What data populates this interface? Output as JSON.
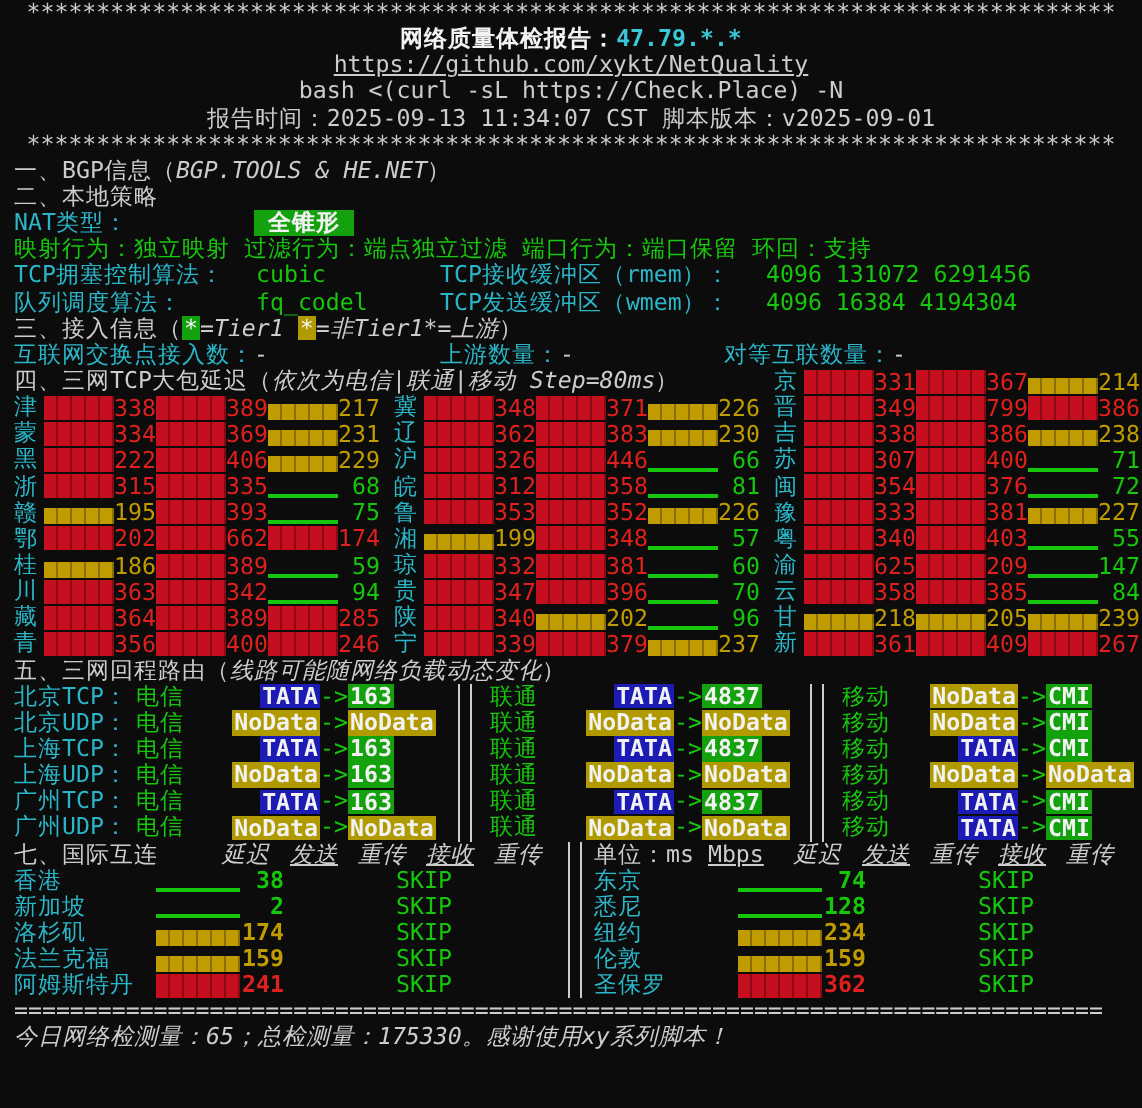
{
  "header_rules": [
    "******************************************************************************",
    "******************************************************************************"
  ],
  "title": {
    "label": "网络质量体检报告：",
    "ip": "47.79.*.*"
  },
  "repo_url": "https://github.com/xykt/NetQuality",
  "command": "bash <(curl -sL https://Check.Place) -N",
  "report_info": "报告时间：2025-09-13 11:34:07 CST  脚本版本：v2025-09-01",
  "bgp": {
    "heading": "一、BGP信息（*BGP.TOOLS & HE.NET*）"
  },
  "local_policy": {
    "heading": "二、本地策略",
    "nat_label": "NAT类型：",
    "nat_type": "全锥形",
    "behaviors": [
      {
        "label": "映射行为：",
        "value": "独立映射"
      },
      {
        "label": "过滤行为：",
        "value": "端点独立过滤"
      },
      {
        "label": "端口行为：",
        "value": "端口保留"
      },
      {
        "label": "环回：",
        "value": "支持"
      }
    ],
    "settings": [
      {
        "label": "TCP拥塞控制算法：",
        "value": "cubic",
        "buffer_label": "TCP接收缓冲区（rmem）：",
        "buffer_value": "4096 131072 6291456"
      },
      {
        "label": "队列调度算法：",
        "value": "fq_codel",
        "buffer_label": "TCP发送缓冲区（wmem）：",
        "buffer_value": "4096 16384 4194304"
      }
    ]
  },
  "access": {
    "heading": "三、接入信息（",
    "legend": [
      {
        "kind": "tier1",
        "mark": "*",
        "text": "=Tier1"
      },
      {
        "kind": "non_tier1",
        "mark": "*",
        "text": "=非Tier1"
      },
      {
        "kind": "upstream",
        "text": "*=上游"
      }
    ],
    "heading_end": "）",
    "counts": [
      {
        "label": "互联网交换点接入数：",
        "value": "-"
      },
      {
        "label": "上游数量：",
        "value": "-"
      },
      {
        "label": "对等互联数量：",
        "value": "-"
      }
    ]
  },
  "tcp_latency": {
    "heading": "四、三网TCP大包延迟（*依次为电信|联通|移动 Step=80ms*）",
    "regions": [
      {
        "name": "京",
        "latencies": [
          {
            "value": "331",
            "kind": "high"
          },
          {
            "value": "367",
            "kind": "high"
          },
          {
            "value": "214",
            "kind": "mid"
          }
        ]
      },
      {
        "name": "津",
        "latencies": [
          {
            "value": "338",
            "kind": "high"
          },
          {
            "value": "389",
            "kind": "high"
          },
          {
            "value": "217",
            "kind": "mid"
          }
        ]
      },
      {
        "name": "冀",
        "latencies": [
          {
            "value": "348",
            "kind": "high"
          },
          {
            "value": "371",
            "kind": "high"
          },
          {
            "value": "226",
            "kind": "mid"
          }
        ]
      },
      {
        "name": "晋",
        "latencies": [
          {
            "value": "349",
            "kind": "high"
          },
          {
            "value": "799",
            "kind": "high"
          },
          {
            "value": "386",
            "kind": "high"
          }
        ]
      },
      {
        "name": "蒙",
        "latencies": [
          {
            "value": "334",
            "kind": "high"
          },
          {
            "value": "369",
            "kind": "high"
          },
          {
            "value": "231",
            "kind": "mid"
          }
        ]
      },
      {
        "name": "辽",
        "latencies": [
          {
            "value": "362",
            "kind": "high"
          },
          {
            "value": "383",
            "kind": "high"
          },
          {
            "value": "230",
            "kind": "mid"
          }
        ]
      },
      {
        "name": "吉",
        "latencies": [
          {
            "value": "338",
            "kind": "high"
          },
          {
            "value": "386",
            "kind": "high"
          },
          {
            "value": "238",
            "kind": "mid"
          }
        ]
      },
      {
        "name": "黑",
        "latencies": [
          {
            "value": "222",
            "kind": "high"
          },
          {
            "value": "406",
            "kind": "high"
          },
          {
            "value": "229",
            "kind": "mid"
          }
        ]
      },
      {
        "name": "沪",
        "latencies": [
          {
            "value": "326",
            "kind": "high"
          },
          {
            "value": "446",
            "kind": "high"
          },
          {
            "value": "66",
            "kind": "low"
          }
        ]
      },
      {
        "name": "苏",
        "latencies": [
          {
            "value": "307",
            "kind": "high"
          },
          {
            "value": "400",
            "kind": "high"
          },
          {
            "value": "71",
            "kind": "low"
          }
        ]
      },
      {
        "name": "浙",
        "latencies": [
          {
            "value": "315",
            "kind": "high"
          },
          {
            "value": "335",
            "kind": "high"
          },
          {
            "value": "68",
            "kind": "low"
          }
        ]
      },
      {
        "name": "皖",
        "latencies": [
          {
            "value": "312",
            "kind": "high"
          },
          {
            "value": "358",
            "kind": "high"
          },
          {
            "value": "81",
            "kind": "low"
          }
        ]
      },
      {
        "name": "闽",
        "latencies": [
          {
            "value": "354",
            "kind": "high"
          },
          {
            "value": "376",
            "kind": "high"
          },
          {
            "value": "72",
            "kind": "low"
          }
        ]
      },
      {
        "name": "赣",
        "latencies": [
          {
            "value": "195",
            "kind": "mid"
          },
          {
            "value": "393",
            "kind": "high"
          },
          {
            "value": "75",
            "kind": "low"
          }
        ]
      },
      {
        "name": "鲁",
        "latencies": [
          {
            "value": "353",
            "kind": "high"
          },
          {
            "value": "352",
            "kind": "high"
          },
          {
            "value": "226",
            "kind": "mid"
          }
        ]
      },
      {
        "name": "豫",
        "latencies": [
          {
            "value": "333",
            "kind": "high"
          },
          {
            "value": "381",
            "kind": "high"
          },
          {
            "value": "227",
            "kind": "mid"
          }
        ]
      },
      {
        "name": "鄂",
        "latencies": [
          {
            "value": "202",
            "kind": "high"
          },
          {
            "value": "662",
            "kind": "high"
          },
          {
            "value": "174",
            "kind": "high"
          }
        ]
      },
      {
        "name": "湘",
        "latencies": [
          {
            "value": "199",
            "kind": "mid"
          },
          {
            "value": "348",
            "kind": "high"
          },
          {
            "value": "57",
            "kind": "low"
          }
        ]
      },
      {
        "name": "粤",
        "latencies": [
          {
            "value": "340",
            "kind": "high"
          },
          {
            "value": "403",
            "kind": "high"
          },
          {
            "value": "55",
            "kind": "low"
          }
        ]
      },
      {
        "name": "桂",
        "latencies": [
          {
            "value": "186",
            "kind": "mid"
          },
          {
            "value": "389",
            "kind": "high"
          },
          {
            "value": "59",
            "kind": "low"
          }
        ]
      },
      {
        "name": "琼",
        "latencies": [
          {
            "value": "332",
            "kind": "high"
          },
          {
            "value": "381",
            "kind": "high"
          },
          {
            "value": "60",
            "kind": "low"
          }
        ]
      },
      {
        "name": "渝",
        "latencies": [
          {
            "value": "625",
            "kind": "high"
          },
          {
            "value": "209",
            "kind": "high"
          },
          {
            "value": "147",
            "kind": "low"
          }
        ]
      },
      {
        "name": "川",
        "latencies": [
          {
            "value": "363",
            "kind": "high"
          },
          {
            "value": "342",
            "kind": "high"
          },
          {
            "value": "94",
            "kind": "low"
          }
        ]
      },
      {
        "name": "贵",
        "latencies": [
          {
            "value": "347",
            "kind": "high"
          },
          {
            "value": "396",
            "kind": "high"
          },
          {
            "value": "70",
            "kind": "low"
          }
        ]
      },
      {
        "name": "云",
        "latencies": [
          {
            "value": "358",
            "kind": "high"
          },
          {
            "value": "385",
            "kind": "high"
          },
          {
            "value": "84",
            "kind": "low"
          }
        ]
      },
      {
        "name": "藏",
        "latencies": [
          {
            "value": "364",
            "kind": "high"
          },
          {
            "value": "389",
            "kind": "high"
          },
          {
            "value": "285",
            "kind": "high"
          }
        ]
      },
      {
        "name": "陕",
        "latencies": [
          {
            "value": "340",
            "kind": "high"
          },
          {
            "value": "202",
            "kind": "mid"
          },
          {
            "value": "96",
            "kind": "low"
          }
        ]
      },
      {
        "name": "甘",
        "latencies": [
          {
            "value": "218",
            "kind": "mid"
          },
          {
            "value": "205",
            "kind": "mid"
          },
          {
            "value": "239",
            "kind": "mid"
          }
        ]
      },
      {
        "name": "青",
        "latencies": [
          {
            "value": "356",
            "kind": "high"
          },
          {
            "value": "400",
            "kind": "high"
          },
          {
            "value": "246",
            "kind": "high"
          }
        ]
      },
      {
        "name": "宁",
        "latencies": [
          {
            "value": "339",
            "kind": "high"
          },
          {
            "value": "379",
            "kind": "high"
          },
          {
            "value": "237",
            "kind": "mid"
          }
        ]
      },
      {
        "name": "新",
        "latencies": [
          {
            "value": "361",
            "kind": "high"
          },
          {
            "value": "409",
            "kind": "high"
          },
          {
            "value": "267",
            "kind": "high"
          }
        ]
      }
    ]
  },
  "return_routes": {
    "heading": "五、三网回程路由（*线路可能随网络负载动态变化*）",
    "rows": [
      {
        "label": "北京TCP：",
        "carriers": [
          {
            "name": "电信",
            "arrow": "->",
            "hops": [
              {
                "text": "TATA",
                "color": "#1c1cb4"
              },
              {
                "text": "163",
                "color": "#13a10e"
              }
            ]
          },
          {
            "name": "联通",
            "arrow": "->",
            "hops": [
              {
                "text": "TATA",
                "color": "#1c1cb4"
              },
              {
                "text": "4837",
                "color": "#13a10e"
              }
            ]
          },
          {
            "name": "移动",
            "arrow": "->",
            "hops": [
              {
                "text": "NoData",
                "color": "#b09a00"
              },
              {
                "text": "CMI",
                "color": "#13a10e"
              }
            ]
          }
        ]
      },
      {
        "label": "北京UDP：",
        "carriers": [
          {
            "name": "电信",
            "arrow": "->",
            "hops": [
              {
                "text": "NoData",
                "color": "#b09a00"
              },
              {
                "text": "NoData",
                "color": "#b09a00"
              }
            ]
          },
          {
            "name": "联通",
            "arrow": "->",
            "hops": [
              {
                "text": "NoData",
                "color": "#b09a00"
              },
              {
                "text": "NoData",
                "color": "#b09a00"
              }
            ]
          },
          {
            "name": "移动",
            "arrow": "->",
            "hops": [
              {
                "text": "NoData",
                "color": "#b09a00"
              },
              {
                "text": "CMI",
                "color": "#13a10e"
              }
            ]
          }
        ]
      },
      {
        "label": "上海TCP：",
        "carriers": [
          {
            "name": "电信",
            "arrow": "->",
            "hops": [
              {
                "text": "TATA",
                "color": "#1c1cb4"
              },
              {
                "text": "163",
                "color": "#13a10e"
              }
            ]
          },
          {
            "name": "联通",
            "arrow": "->",
            "hops": [
              {
                "text": "TATA",
                "color": "#1c1cb4"
              },
              {
                "text": "4837",
                "color": "#13a10e"
              }
            ]
          },
          {
            "name": "移动",
            "arrow": "->",
            "hops": [
              {
                "text": "TATA",
                "color": "#1c1cb4"
              },
              {
                "text": "CMI",
                "color": "#13a10e"
              }
            ]
          }
        ]
      },
      {
        "label": "上海UDP：",
        "carriers": [
          {
            "name": "电信",
            "arrow": "->",
            "hops": [
              {
                "text": "NoData",
                "color": "#b09a00"
              },
              {
                "text": "163",
                "color": "#13a10e"
              }
            ]
          },
          {
            "name": "联通",
            "arrow": "->",
            "hops": [
              {
                "text": "NoData",
                "color": "#b09a00"
              },
              {
                "text": "NoData",
                "color": "#b09a00"
              }
            ]
          },
          {
            "name": "移动",
            "arrow": "->",
            "hops": [
              {
                "text": "NoData",
                "color": "#b09a00"
              },
              {
                "text": "NoData",
                "color": "#b09a00"
              }
            ]
          }
        ]
      },
      {
        "label": "广州TCP：",
        "carriers": [
          {
            "name": "电信",
            "arrow": "->",
            "hops": [
              {
                "text": "TATA",
                "color": "#1c1cb4"
              },
              {
                "text": "163",
                "color": "#13a10e"
              }
            ]
          },
          {
            "name": "联通",
            "arrow": "->",
            "hops": [
              {
                "text": "TATA",
                "color": "#1c1cb4"
              },
              {
                "text": "4837",
                "color": "#13a10e"
              }
            ]
          },
          {
            "name": "移动",
            "arrow": "->",
            "hops": [
              {
                "text": "TATA",
                "color": "#1c1cb4"
              },
              {
                "text": "CMI",
                "color": "#13a10e"
              }
            ]
          }
        ]
      },
      {
        "label": "广州UDP：",
        "carriers": [
          {
            "name": "电信",
            "arrow": "->",
            "hops": [
              {
                "text": "NoData",
                "color": "#b09a00"
              },
              {
                "text": "NoData",
                "color": "#b09a00"
              }
            ]
          },
          {
            "name": "联通",
            "arrow": "->",
            "hops": [
              {
                "text": "NoData",
                "color": "#b09a00"
              },
              {
                "text": "NoData",
                "color": "#b09a00"
              }
            ]
          },
          {
            "name": "移动",
            "arrow": "->",
            "hops": [
              {
                "text": "TATA",
                "color": "#1c1cb4"
              },
              {
                "text": "CMI",
                "color": "#13a10e"
              }
            ]
          }
        ]
      }
    ]
  },
  "international": {
    "heading": "七、国际互连",
    "unit": "单位：ms",
    "unit_rate": "Mbps",
    "halves": [
      {
        "columns": [
          {
            "text": "延迟",
            "underlined": false
          },
          {
            "text": "发送",
            "underlined": true
          },
          {
            "text": "重传",
            "underlined": false
          },
          {
            "text": "接收",
            "underlined": true
          },
          {
            "text": "重传",
            "underlined": false
          }
        ],
        "rows": [
          {
            "name": "香港",
            "latency": "38",
            "kind": "low",
            "result": "SKIP"
          },
          {
            "name": "新加坡",
            "latency": "2",
            "kind": "low",
            "result": "SKIP"
          },
          {
            "name": "洛杉矶",
            "latency": "174",
            "kind": "mid",
            "result": "SKIP"
          },
          {
            "name": "法兰克福",
            "latency": "159",
            "kind": "mid",
            "result": "SKIP"
          },
          {
            "name": "阿姆斯特丹",
            "latency": "241",
            "kind": "high",
            "result": "SKIP"
          }
        ]
      },
      {
        "columns": [
          {
            "text": "延迟",
            "underlined": false
          },
          {
            "text": "发送",
            "underlined": true
          },
          {
            "text": "重传",
            "underlined": false
          },
          {
            "text": "接收",
            "underlined": true
          },
          {
            "text": "重传",
            "underlined": false
          }
        ],
        "rows": [
          {
            "name": "东京",
            "latency": "74",
            "kind": "low",
            "result": "SKIP"
          },
          {
            "name": "悉尼",
            "latency": "128",
            "kind": "low",
            "result": "SKIP"
          },
          {
            "name": "纽约",
            "latency": "234",
            "kind": "mid",
            "result": "SKIP"
          },
          {
            "name": "伦敦",
            "latency": "159",
            "kind": "mid",
            "result": "SKIP"
          },
          {
            "name": "圣保罗",
            "latency": "362",
            "kind": "high",
            "result": "SKIP"
          }
        ]
      }
    ]
  },
  "footer": {
    "rule": "==============================================================================",
    "message": "今日网络检测量：65；总检测量：175330。感谢使用xy系列脚本！"
  }
}
